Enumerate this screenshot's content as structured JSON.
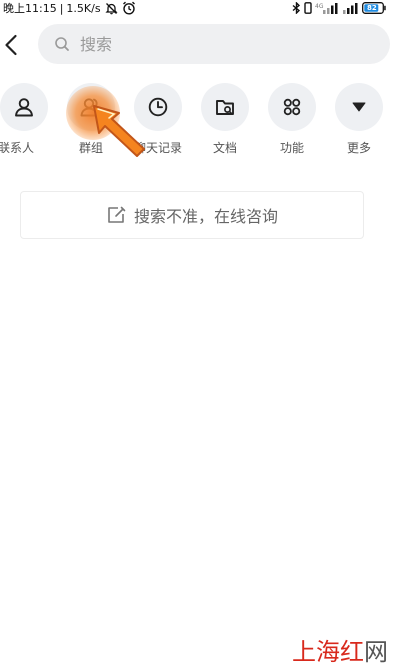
{
  "status_bar": {
    "time": "晚上11:15",
    "separator": "|",
    "network_speed": "1.5K/s",
    "icons": [
      "mute-bell-icon",
      "alarm-clock-icon",
      "bluetooth-icon",
      "vibrate-icon",
      "signal-4g-icon",
      "signal-icon",
      "battery-icon"
    ],
    "battery_level": "82"
  },
  "search": {
    "placeholder": "搜索",
    "value": ""
  },
  "categories": [
    {
      "label": "联系人",
      "icon": "person-icon"
    },
    {
      "label": "群组",
      "icon": "group-icon"
    },
    {
      "label": "聊天记录",
      "icon": "clock-icon"
    },
    {
      "label": "文档",
      "icon": "folder-icon"
    },
    {
      "label": "功能",
      "icon": "grid-icon"
    },
    {
      "label": "更多",
      "icon": "triangle-down-icon"
    }
  ],
  "consult": {
    "label": "搜索不准，在线咨询",
    "icon": "edit-icon"
  },
  "watermark": {
    "text_red": "上海红",
    "text_gray": "网"
  },
  "colors": {
    "highlight": "#f07d28",
    "search_bg": "#eff0f2",
    "icon_circle_bg": "#eef0f3",
    "watermark_red": "#d8291c",
    "watermark_gray": "#555555"
  }
}
